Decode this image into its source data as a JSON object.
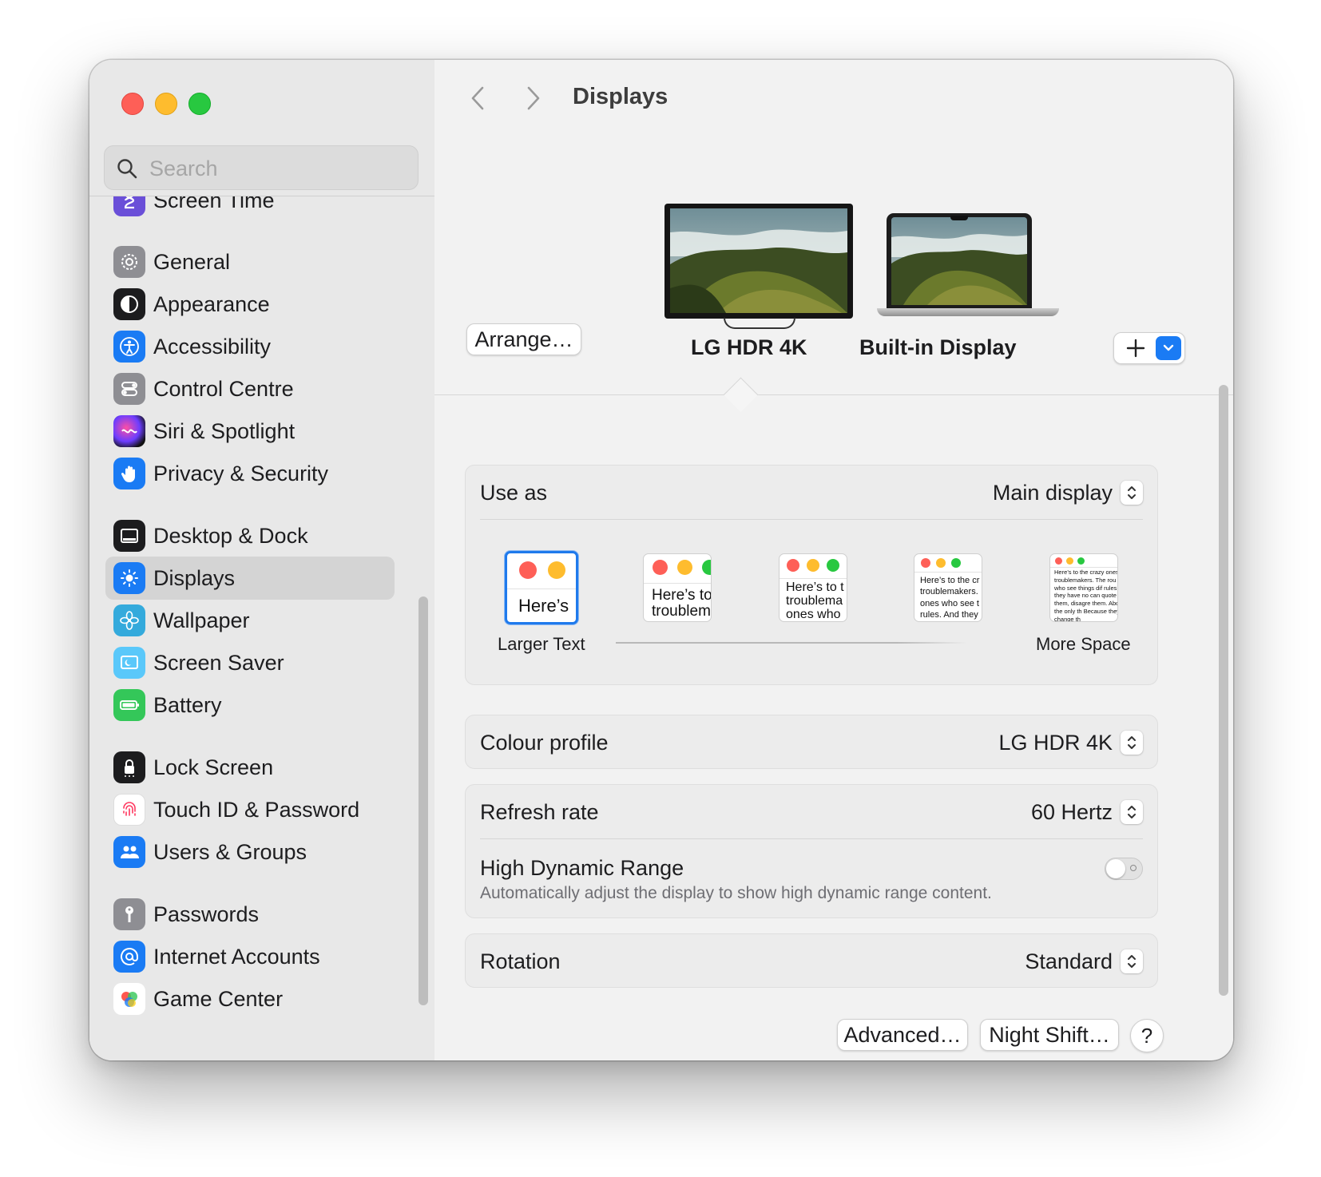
{
  "search": {
    "placeholder": "Search"
  },
  "sidebar": {
    "items": [
      {
        "label": "Screen Time",
        "icon": "hourglass-icon"
      },
      {
        "label": "General",
        "icon": "gear-icon"
      },
      {
        "label": "Appearance",
        "icon": "appearance-icon"
      },
      {
        "label": "Accessibility",
        "icon": "accessibility-icon"
      },
      {
        "label": "Control Centre",
        "icon": "control-centre-icon"
      },
      {
        "label": "Siri & Spotlight",
        "icon": "siri-icon"
      },
      {
        "label": "Privacy & Security",
        "icon": "hand-icon"
      },
      {
        "label": "Desktop & Dock",
        "icon": "dock-icon"
      },
      {
        "label": "Displays",
        "icon": "sun-icon",
        "selected": true
      },
      {
        "label": "Wallpaper",
        "icon": "flower-icon"
      },
      {
        "label": "Screen Saver",
        "icon": "screensaver-icon"
      },
      {
        "label": "Battery",
        "icon": "battery-icon"
      },
      {
        "label": "Lock Screen",
        "icon": "lock-icon"
      },
      {
        "label": "Touch ID & Password",
        "icon": "fingerprint-icon"
      },
      {
        "label": "Users & Groups",
        "icon": "users-icon"
      },
      {
        "label": "Passwords",
        "icon": "key-icon"
      },
      {
        "label": "Internet Accounts",
        "icon": "at-icon"
      },
      {
        "label": "Game Center",
        "icon": "game-center-icon"
      }
    ]
  },
  "header": {
    "title": "Displays"
  },
  "displays": {
    "arrange_label": "Arrange…",
    "items": [
      {
        "name": "LG HDR 4K",
        "selected": true
      },
      {
        "name": "Built-in Display",
        "selected": false
      }
    ]
  },
  "settings": {
    "use_as": {
      "label": "Use as",
      "value": "Main display"
    },
    "scale": {
      "left_label": "Larger Text",
      "right_label": "More Space",
      "selected_index": 0,
      "samples": [
        "Here’s",
        "Here’s to troublem",
        "Here’s to t troublema ones who",
        "Here’s to the cr troublemakers. ones who see t rules. And they",
        "Here’s to the crazy ones troublemakers. The rou ones who see things dif rules. And they have no can quote them, disagre them. About the only th Because they change th"
      ]
    },
    "colour_profile": {
      "label": "Colour profile",
      "value": "LG HDR 4K"
    },
    "refresh_rate": {
      "label": "Refresh rate",
      "value": "60 Hertz"
    },
    "hdr": {
      "label": "High Dynamic Range",
      "description": "Automatically adjust the display to show high dynamic range content.",
      "enabled": false
    },
    "rotation": {
      "label": "Rotation",
      "value": "Standard"
    }
  },
  "footer": {
    "advanced_label": "Advanced…",
    "night_shift_label": "Night Shift…",
    "help_label": "?"
  },
  "colors": {
    "accent": "#1a7bf4",
    "close": "#fe5f57",
    "minimize": "#febc2e",
    "maximize": "#28c840"
  }
}
